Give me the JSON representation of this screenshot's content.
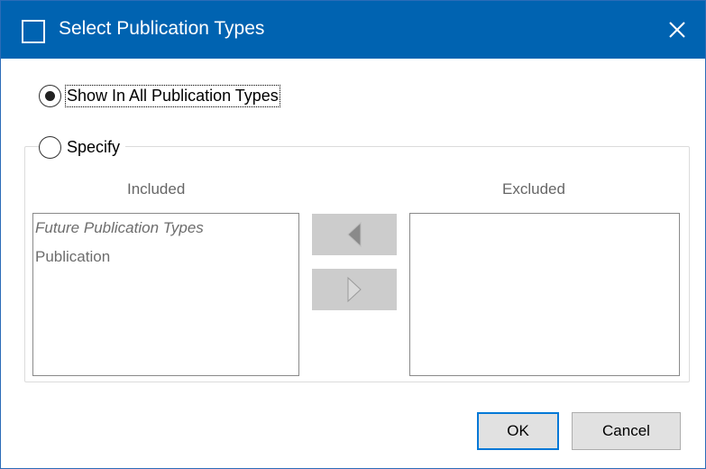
{
  "dialog": {
    "title": "Select Publication Types",
    "icons": {
      "app": "window-icon",
      "close": "close-icon",
      "move_left": "triangle-left-icon",
      "move_right": "triangle-right-icon"
    },
    "colors": {
      "titlebar": "#0063b1",
      "accent": "#0078d7",
      "button_bg": "#e1e1e1",
      "move_button_bg": "#cccccc"
    }
  },
  "options": {
    "show_all": {
      "label": "Show In All Publication Types",
      "selected": true
    },
    "specify": {
      "label": "Specify",
      "selected": false
    }
  },
  "lists": {
    "included_header": "Included",
    "excluded_header": "Excluded",
    "included_items": [
      {
        "label": "Future Publication Types",
        "italic": true
      },
      {
        "label": "Publication",
        "italic": false
      }
    ],
    "excluded_items": []
  },
  "buttons": {
    "ok": "OK",
    "cancel": "Cancel"
  }
}
